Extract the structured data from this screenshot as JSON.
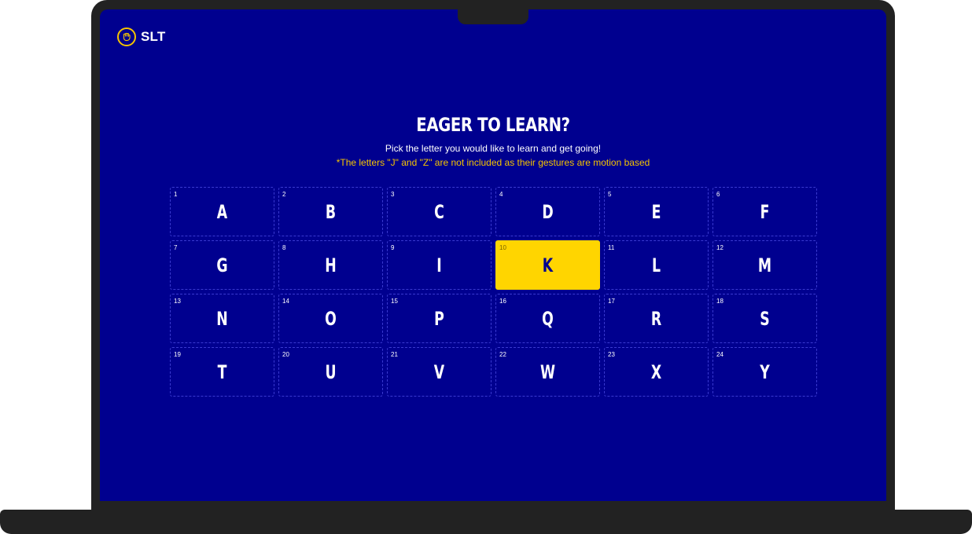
{
  "brand": {
    "name": "SLT",
    "icon": "hand-fist-icon",
    "accent_color": "#f5c400"
  },
  "heading": {
    "title": "EAGER TO LEARN?",
    "subtitle": "Pick the letter you would like to learn and get going!",
    "note": "*The letters \"J\" and \"Z\" are not included as their gestures are motion based"
  },
  "colors": {
    "background": "#00008f",
    "selected_card": "#ffd500",
    "note_text": "#f5c400"
  },
  "letters": [
    {
      "num": "1",
      "letter": "A"
    },
    {
      "num": "2",
      "letter": "B"
    },
    {
      "num": "3",
      "letter": "C"
    },
    {
      "num": "4",
      "letter": "D"
    },
    {
      "num": "5",
      "letter": "E"
    },
    {
      "num": "6",
      "letter": "F"
    },
    {
      "num": "7",
      "letter": "G"
    },
    {
      "num": "8",
      "letter": "H"
    },
    {
      "num": "9",
      "letter": "I"
    },
    {
      "num": "10",
      "letter": "K",
      "selected": true
    },
    {
      "num": "11",
      "letter": "L"
    },
    {
      "num": "12",
      "letter": "M"
    },
    {
      "num": "13",
      "letter": "N"
    },
    {
      "num": "14",
      "letter": "O"
    },
    {
      "num": "15",
      "letter": "P"
    },
    {
      "num": "16",
      "letter": "Q"
    },
    {
      "num": "17",
      "letter": "R"
    },
    {
      "num": "18",
      "letter": "S"
    },
    {
      "num": "19",
      "letter": "T"
    },
    {
      "num": "20",
      "letter": "U"
    },
    {
      "num": "21",
      "letter": "V"
    },
    {
      "num": "22",
      "letter": "W"
    },
    {
      "num": "23",
      "letter": "X"
    },
    {
      "num": "24",
      "letter": "Y"
    }
  ]
}
